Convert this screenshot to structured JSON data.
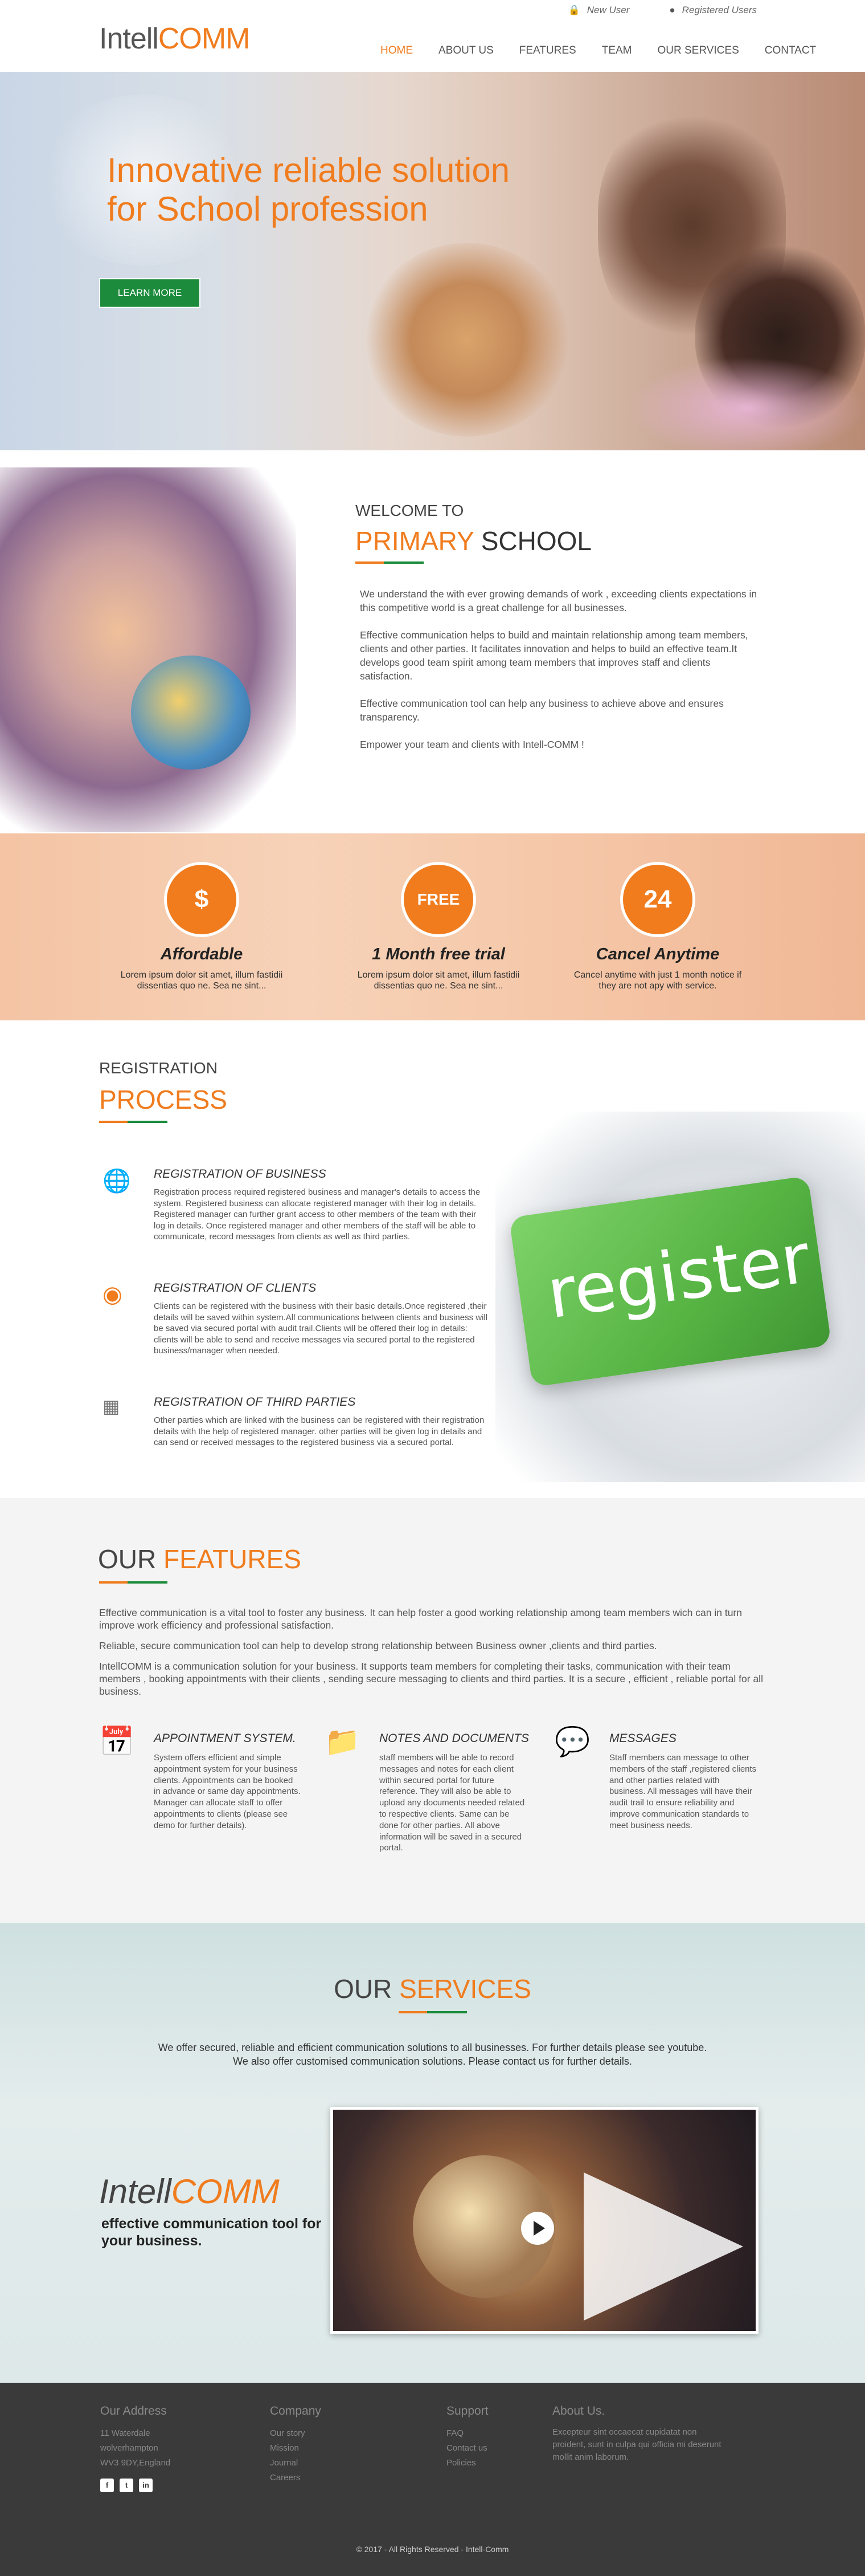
{
  "header": {
    "logo_main": "Intell",
    "logo_accent": "COMM",
    "new_user": "New User",
    "registered_users": "Registered Users",
    "nav": [
      "HOME",
      "ABOUT US",
      "FEATURES",
      "TEAM",
      "OUR SERVICES",
      "CONTACT"
    ],
    "active_nav": "HOME"
  },
  "hero": {
    "title_line1": "Innovative reliable solution",
    "title_line2": "for School profession",
    "button": "LEARN MORE"
  },
  "welcome": {
    "small_title": "WELCOME TO",
    "big_accent": "PRIMARY",
    "big_rest": " SCHOOL",
    "paragraphs": [
      "We understand the with ever growing demands of work , exceeding clients expectations in this competitive world is a great challenge for all businesses.",
      "Effective communication helps to build and maintain relationship among team members, clients and other parties. It facilitates innovation and helps to build an effective team.It develops good team spirit among team members that improves staff and clients satisfaction.",
      "Effective communication tool can help any business to achieve above and ensures transparency.",
      "Empower your team and clients with Intell-COMM !"
    ]
  },
  "benefits": [
    {
      "icon": "$",
      "title": "Affordable",
      "desc": "Lorem ipsum dolor sit amet, illum fastidii dissentias quo ne. Sea ne sint..."
    },
    {
      "icon": "FREE",
      "title": "1 Month free trial",
      "desc": "Lorem ipsum dolor sit amet, illum fastidii dissentias quo ne. Sea ne sint..."
    },
    {
      "icon": "24",
      "title": "Cancel Anytime",
      "desc": "Cancel anytime with just 1 month notice if they are not apy with service."
    }
  ],
  "registration": {
    "small_title": "REGISTRATION",
    "big_title": "PROCESS",
    "key_text": "register",
    "items": [
      {
        "icon": "globe-users",
        "title": "REGISTRATION OF BUSINESS",
        "desc": "Registration process required registered business and manager's details to access the system. Registered business can allocate registered manager with their log in details. Registered manager can further grant access to other members of the team with their log in details. Once registered manager and other members of the staff will be able to communicate, record messages from clients as well as third parties."
      },
      {
        "icon": "user",
        "title": "REGISTRATION OF CLIENTS",
        "desc": "Clients can be registered with the business with their basic details.Once registered ,their details will be saved within system.All communications between clients and business will be saved via secured portal with audit trail.Clients will be offered their log in details: clients will be able to send and receive messages via secured portal to the registered business/manager when needed."
      },
      {
        "icon": "org-chart",
        "title": "REGISTRATION OF THIRD PARTIES",
        "desc": "Other parties which are linked with the business can be registered with their registration details with the help of registered manager. other parties will be given log in details and can send or received messages to the registered business via a secured portal."
      }
    ]
  },
  "features": {
    "title_plain": "OUR ",
    "title_accent": "FEATURES",
    "paragraphs": [
      "Effective communication is a vital tool to foster any business.  It can help foster a good working relationship among team members wich can in turn improve work efficiency and professional satisfaction.",
      "Reliable, secure communication tool can help to develop strong relationship between Business owner ,clients and third parties.",
      "IntellCOMM is a communication solution for your business. It supports team members for completing their tasks, communication with their team members , booking appointments with their clients , sending secure messaging to clients and third parties. It is a secure , efficient , reliable portal for all business."
    ],
    "columns": [
      {
        "icon": "calendar",
        "title": "APPOINTMENT SYSTEM.",
        "desc": "System offers efficient and simple appointment system for your business clients. Appointments can be booked in advance or same day appointments. Manager can allocate staff to offer appointments to clients (please see demo for further details)."
      },
      {
        "icon": "folder",
        "title": "NOTES AND DOCUMENTS",
        "desc": "staff members will be able to record messages and notes for each client within secured portal for future reference. They will also be able to upload any documents needed related to respective clients. Same can be done for other parties. All above information will be saved in a secured portal."
      },
      {
        "icon": "chat",
        "title": "MESSAGES",
        "desc": "Staff members can message to other members of the staff ,registered clients and other parties related with business. All messages will have their audit trail to ensure reliability and improve communication standards to meet business needs."
      }
    ]
  },
  "services": {
    "title_plain": "OUR ",
    "title_accent": "SERVICES",
    "line1": "We offer secured, reliable and efficient communication solutions to all businesses. For further details please see youtube.",
    "line2": "We also offer customised communication solutions. Please contact us for further details.",
    "logo_main": "Intell",
    "logo_accent": "COMM",
    "tagline": "effective communication tool for your business."
  },
  "footer": {
    "address_head": "Our Address",
    "address_lines": [
      "11 Waterdale",
      "wolverhampton",
      "WV3 9DY,England"
    ],
    "company_head": "Company",
    "company_links": [
      "Our story",
      "Mission",
      "Journal",
      "Careers"
    ],
    "support_head": "Support",
    "support_links": [
      "FAQ",
      "Contact us",
      "Policies"
    ],
    "about_head": "About Us.",
    "about_text": "Excepteur sint occaecat cupidatat non proident, sunt in culpa qui officia mi deserunt mollit anim laborum.",
    "social": [
      "f",
      "t",
      "in"
    ],
    "copyright": "© 2017 - All Rights Reserved - Intell-Comm"
  },
  "colors": {
    "accent": "#f07c1e",
    "green": "#1c8c3c",
    "footer_bg": "#3a3a3a"
  }
}
